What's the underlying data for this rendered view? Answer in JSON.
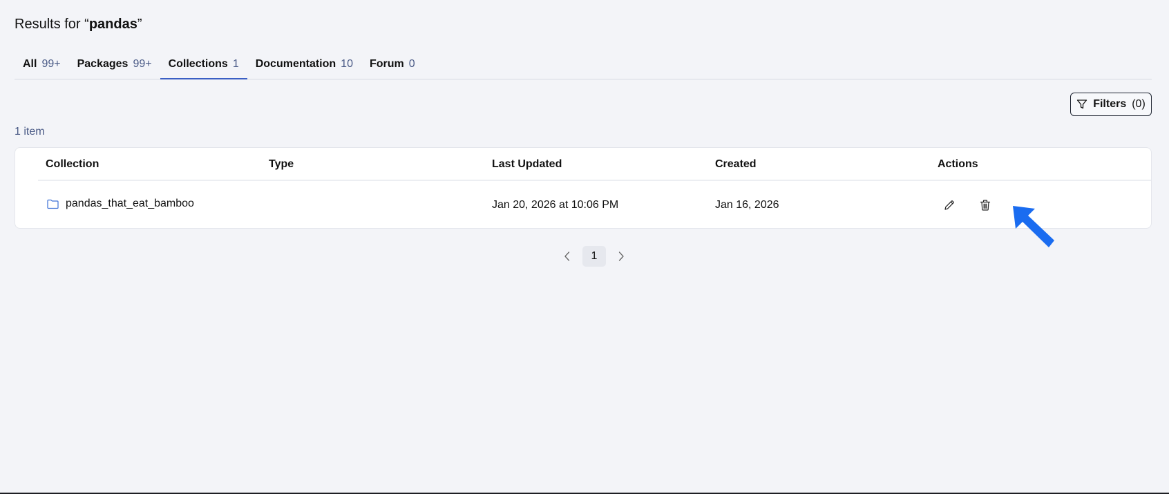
{
  "header": {
    "prefix": "Results for “",
    "query": "pandas",
    "suffix": "”"
  },
  "tabs": [
    {
      "label": "All",
      "count": "99+"
    },
    {
      "label": "Packages",
      "count": "99+"
    },
    {
      "label": "Collections",
      "count": "1",
      "active": true
    },
    {
      "label": "Documentation",
      "count": "10"
    },
    {
      "label": "Forum",
      "count": "0"
    }
  ],
  "filters": {
    "label": "Filters",
    "count": "(0)"
  },
  "results": {
    "count_label": "1 item"
  },
  "table": {
    "columns": [
      "Collection",
      "Type",
      "Last Updated",
      "Created",
      "Actions"
    ],
    "rows": [
      {
        "collection": "pandas_that_eat_bamboo",
        "type": "",
        "last_updated": "Jan 20, 2026 at 10:06 PM",
        "created": "Jan 16, 2026"
      }
    ]
  },
  "pagination": {
    "current": "1"
  },
  "icons": {
    "folder": "folder-icon",
    "edit": "pencil-icon",
    "delete": "trash-icon",
    "filter": "filter-icon",
    "prev": "chevron-left-icon",
    "next": "chevron-right-icon",
    "cursor": "arrow-pointer-icon"
  },
  "colors": {
    "background": "#f3f4f8",
    "accent": "#3b5fc4",
    "count_text": "#4a5a86",
    "folder_icon": "#3b6fd6",
    "cursor_arrow": "#1a6cf0"
  }
}
